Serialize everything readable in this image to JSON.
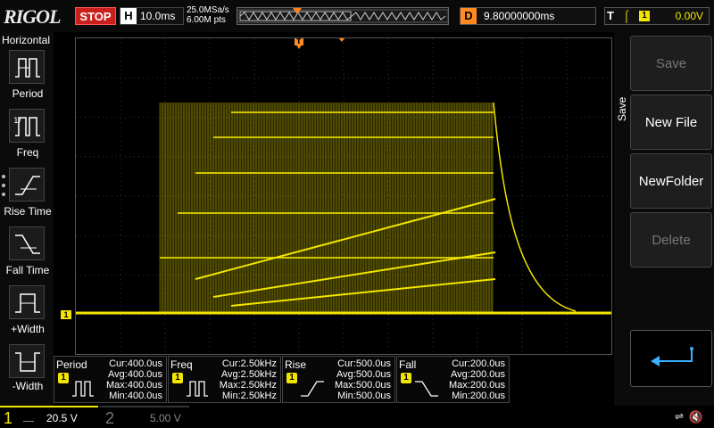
{
  "brand": "RIGOL",
  "run_state": "STOP",
  "timebase": {
    "label": "H",
    "value": "10.0ms"
  },
  "sample": {
    "rate": "25.0MSa/s",
    "points": "6.00M pts"
  },
  "delay": {
    "label": "D",
    "value": "9.80000000ms"
  },
  "trigger": {
    "label": "T",
    "edge_icon": "rising-edge-icon",
    "channel": "1",
    "level": "0.00V"
  },
  "left_menu": {
    "title": "Horizontal",
    "items": [
      {
        "label": "Period",
        "icon": "period-icon"
      },
      {
        "label": "Freq",
        "icon": "freq-icon"
      },
      {
        "label": "Rise Time",
        "icon": "rise-time-icon"
      },
      {
        "label": "Fall Time",
        "icon": "fall-time-icon"
      },
      {
        "label": "+Width",
        "icon": "pos-width-icon"
      },
      {
        "label": "-Width",
        "icon": "neg-width-icon"
      }
    ]
  },
  "right_menu": {
    "title": "Save",
    "buttons": [
      {
        "label": "Save",
        "enabled": false
      },
      {
        "label": "New File",
        "enabled": true
      },
      {
        "label": "NewFolder",
        "enabled": true
      },
      {
        "label": "Delete",
        "enabled": false
      },
      {
        "label": "",
        "icon": "enter-icon",
        "enabled": true
      }
    ]
  },
  "markers": {
    "ch1": "1",
    "trigger_pos": "T"
  },
  "measurements": [
    {
      "name": "Period",
      "channel": "1",
      "cur": "Cur:400.0us",
      "avg": "Avg:400.0us",
      "max": "Max:400.0us",
      "min": "Min:400.0us"
    },
    {
      "name": "Freq",
      "channel": "1",
      "cur": "Cur:2.50kHz",
      "avg": "Avg:2.50kHz",
      "max": "Max:2.50kHz",
      "min": "Min:2.50kHz"
    },
    {
      "name": "Rise",
      "channel": "1",
      "cur": "Cur:500.0us",
      "avg": "Avg:500.0us",
      "max": "Max:500.0us",
      "min": "Min:500.0us"
    },
    {
      "name": "Fall",
      "channel": "1",
      "cur": "Cur:200.0us",
      "avg": "Avg:200.0us",
      "max": "Max:200.0us",
      "min": "Min:200.0us"
    }
  ],
  "channels": [
    {
      "num": "1",
      "scale": "20.5 V",
      "active": true
    },
    {
      "num": "2",
      "scale": "5.00 V",
      "active": false
    }
  ],
  "colors": {
    "ch1": "#f2e600",
    "trigger": "#ff8a1f",
    "stop": "#c9201d"
  }
}
